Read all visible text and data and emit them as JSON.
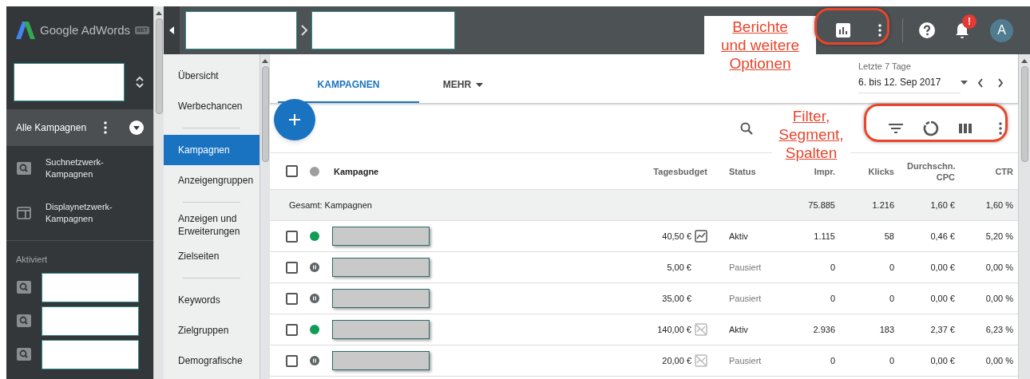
{
  "sidebar": {
    "logo": "Google AdWords",
    "badge": "BET",
    "all_campaigns": "Alle Kampagnen",
    "campaign_types": [
      {
        "label": "Suchnetzwerk-Kampagnen",
        "kind": "search"
      },
      {
        "label": "Displaynetzwerk-Kampagnen",
        "kind": "display"
      }
    ],
    "section": "Aktiviert",
    "active_campaigns": [
      {
        "kind": "search"
      },
      {
        "kind": "search"
      },
      {
        "kind": "search"
      }
    ]
  },
  "topbar": {
    "notification_badge": "!",
    "avatar": "A"
  },
  "nav": [
    [
      {
        "label": "Übersicht",
        "selected": false
      },
      {
        "label": "Werbechancen",
        "selected": false
      }
    ],
    [
      {
        "label": "Kampagnen",
        "selected": true
      },
      {
        "label": "Anzeigengruppen",
        "selected": false
      }
    ],
    [
      {
        "label": "Anzeigen und Erweiterungen",
        "selected": false
      },
      {
        "label": "Zielseiten",
        "selected": false
      }
    ],
    [
      {
        "label": "Keywords",
        "selected": false
      },
      {
        "label": "Zielgruppen",
        "selected": false
      },
      {
        "label": "Demografische",
        "selected": false
      }
    ]
  ],
  "tabs": [
    {
      "label": "KAMPAGNEN",
      "selected": true
    },
    {
      "label": "MEHR",
      "selected": false
    }
  ],
  "date": {
    "label": "Letzte 7 Tage",
    "value": "6. bis 12. Sep 2017"
  },
  "table": {
    "header_checked": false,
    "columns": [
      "Kampagne",
      "Tagesbudget",
      "Status",
      "Impr.",
      "Klicks",
      "Durchschn. CPC",
      "CTR"
    ],
    "total": {
      "label": "Gesamt: Kampagnen",
      "impr": "75.885",
      "clicks": "1.216",
      "cpc": "1,60 €",
      "ctr": "1,60 %"
    },
    "rows": [
      {
        "checked": false,
        "kind": "active",
        "budget": "40,50 €",
        "budget_icon": {
          "kind": "trend"
        },
        "status": "Aktiv",
        "impr": "1.115",
        "clicks": "58",
        "cpc": "0,46 €",
        "ctr": "5,20 %"
      },
      {
        "checked": false,
        "kind": "paused",
        "budget": "5,00 €",
        "status": "Pausiert",
        "impr": "0",
        "clicks": "0",
        "cpc": "0,00 €",
        "ctr": "0,00 %"
      },
      {
        "checked": false,
        "kind": "paused",
        "budget": "35,00 €",
        "status": "Pausiert",
        "impr": "0",
        "clicks": "0",
        "cpc": "0,00 €",
        "ctr": "0,00 %"
      },
      {
        "checked": false,
        "kind": "active",
        "budget": "140,00 €",
        "budget_icon": {
          "kind": "no-data"
        },
        "status": "Aktiv",
        "impr": "2.936",
        "clicks": "183",
        "cpc": "2,37 €",
        "ctr": "6,23 %"
      },
      {
        "checked": false,
        "kind": "paused",
        "budget": "20,00 €",
        "budget_icon": {
          "kind": "no-data"
        },
        "status": "Pausiert",
        "impr": "0",
        "clicks": "0",
        "cpc": "0,00 €",
        "ctr": "0,00 %"
      }
    ]
  },
  "annotations": [
    {
      "lines": [
        "Berichte",
        "und weitere",
        "Optionen"
      ]
    },
    {
      "lines": [
        "Filter,",
        "Segment,",
        "Spalten"
      ]
    }
  ]
}
